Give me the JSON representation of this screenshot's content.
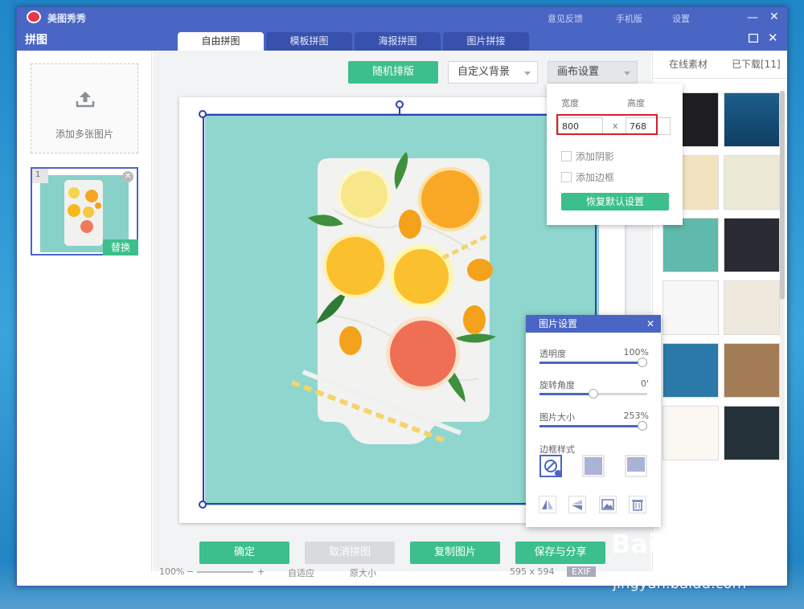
{
  "app": {
    "name": "美图秀秀",
    "window_title": "拼图",
    "strip_links": [
      "意见反馈",
      "手机版",
      "设置"
    ]
  },
  "tabs": [
    {
      "label": "自由拼图",
      "active": true
    },
    {
      "label": "模板拼图",
      "active": false
    },
    {
      "label": "海报拼图",
      "active": false
    },
    {
      "label": "图片拼接",
      "active": false
    }
  ],
  "left_panel": {
    "add_label": "添加多张图片",
    "thumb_index": "1",
    "replace_label": "替换"
  },
  "toolbar": {
    "random_layout": "随机排版",
    "custom_bg": "自定义背景",
    "canvas_settings": "画布设置"
  },
  "canvas_popup": {
    "width_label": "宽度",
    "height_label": "高度",
    "width_value": "800",
    "height_value": "768",
    "times": "x",
    "add_shadow": "添加阴影",
    "add_border": "添加边框",
    "reset": "恢复默认设置"
  },
  "image_settings": {
    "title": "图片设置",
    "close": "✕",
    "opacity_label": "透明度",
    "opacity_value": "100%",
    "opacity_level": 1.0,
    "rotation_label": "旋转角度",
    "rotation_value": "0'",
    "rotation_level": 0.5,
    "size_label": "图片大小",
    "size_value": "253%",
    "size_level": 1.0,
    "border_style_label": "边框样式"
  },
  "bottom_buttons": {
    "confirm": "确定",
    "cancel": "取消拼图",
    "copy": "复制图片",
    "save_share": "保存与分享"
  },
  "statusbar": {
    "zoom": "100%",
    "minus": "−",
    "plus": "+",
    "fit": "自适应",
    "original": "原大小",
    "dimensions": "595 x 594",
    "exif": "EXIF"
  },
  "right_panel": {
    "tab_online": "在线素材",
    "tab_downloaded": "已下载[11]"
  },
  "watermark": {
    "brand": "Bai du 经验",
    "url": "jingyan.baidu.com"
  },
  "colors": {
    "accent_blue": "#4a66c4",
    "green": "#3cbf8c",
    "highlight_red": "#d4202a"
  }
}
